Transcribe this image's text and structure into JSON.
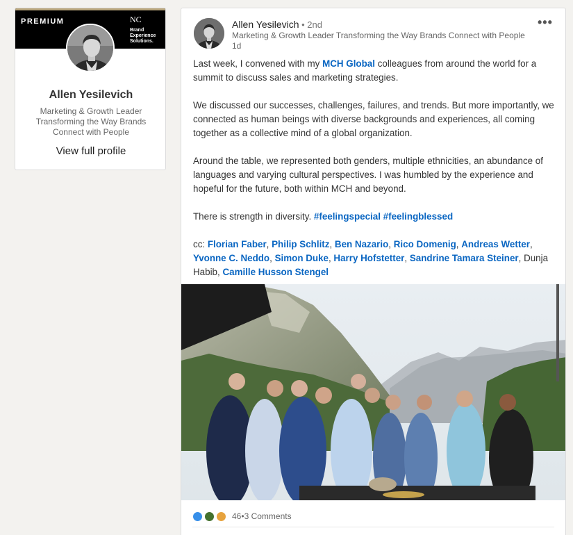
{
  "sidebar_profile": {
    "premium_label": "PREMIUM",
    "logo_mark": "NC",
    "logo_text": [
      "Brand",
      "Experience",
      "Solutions."
    ],
    "name": "Allen Yesilevich",
    "headline": "Marketing & Growth Leader Transforming the Way Brands Connect with People",
    "view_profile_label": "View full profile"
  },
  "post": {
    "author_name": "Allen Yesilevich",
    "degree": " • 2nd",
    "author_headline": "Marketing & Growth Leader Transforming the Way Brands Connect with People",
    "time": "1d",
    "more_menu": "•••",
    "paragraph1": {
      "before": "Last week, I convened with my ",
      "link": "MCH Global",
      "after": " colleagues from around the world for a summit to discuss sales and marketing strategies."
    },
    "paragraph2": "We discussed our successes, challenges, failures, and trends. But more importantly, we connected as human beings with diverse backgrounds and experiences, all coming together as a collective mind of a global organization.",
    "paragraph3": "Around the table, we represented both genders, multiple ethnicities, an abundance of languages and varying cultural perspectives. I was humbled by the experience and hopeful for the future, both within MCH and beyond.",
    "paragraph4": {
      "text": "There is strength in diversity. ",
      "hashtags": [
        "#feelingspecial",
        "#feelingblessed"
      ]
    },
    "cc": {
      "prefix": "cc: ",
      "mentions": [
        "Florian Faber",
        "Philip Schlitz",
        "Ben Nazario",
        "Rico Domenig",
        "Andreas Wetter",
        "Yvonne C. Neddo",
        "Simon Duke",
        "Harry Hofstetter",
        "Sandrine Tamara Steiner"
      ],
      "plain_name": "Dunja Habib",
      "last_mention": "Camille Husson Stengel"
    },
    "reactions": {
      "icons": [
        "like-icon",
        "celebrate-icon",
        "insightful-icon"
      ],
      "count": "46",
      "separator": " • ",
      "comments": "3 Comments"
    },
    "colors": {
      "link": "#0a66c2",
      "like": "#378fe9",
      "celebrate": "#44712e",
      "insightful": "#e7a33e"
    }
  }
}
